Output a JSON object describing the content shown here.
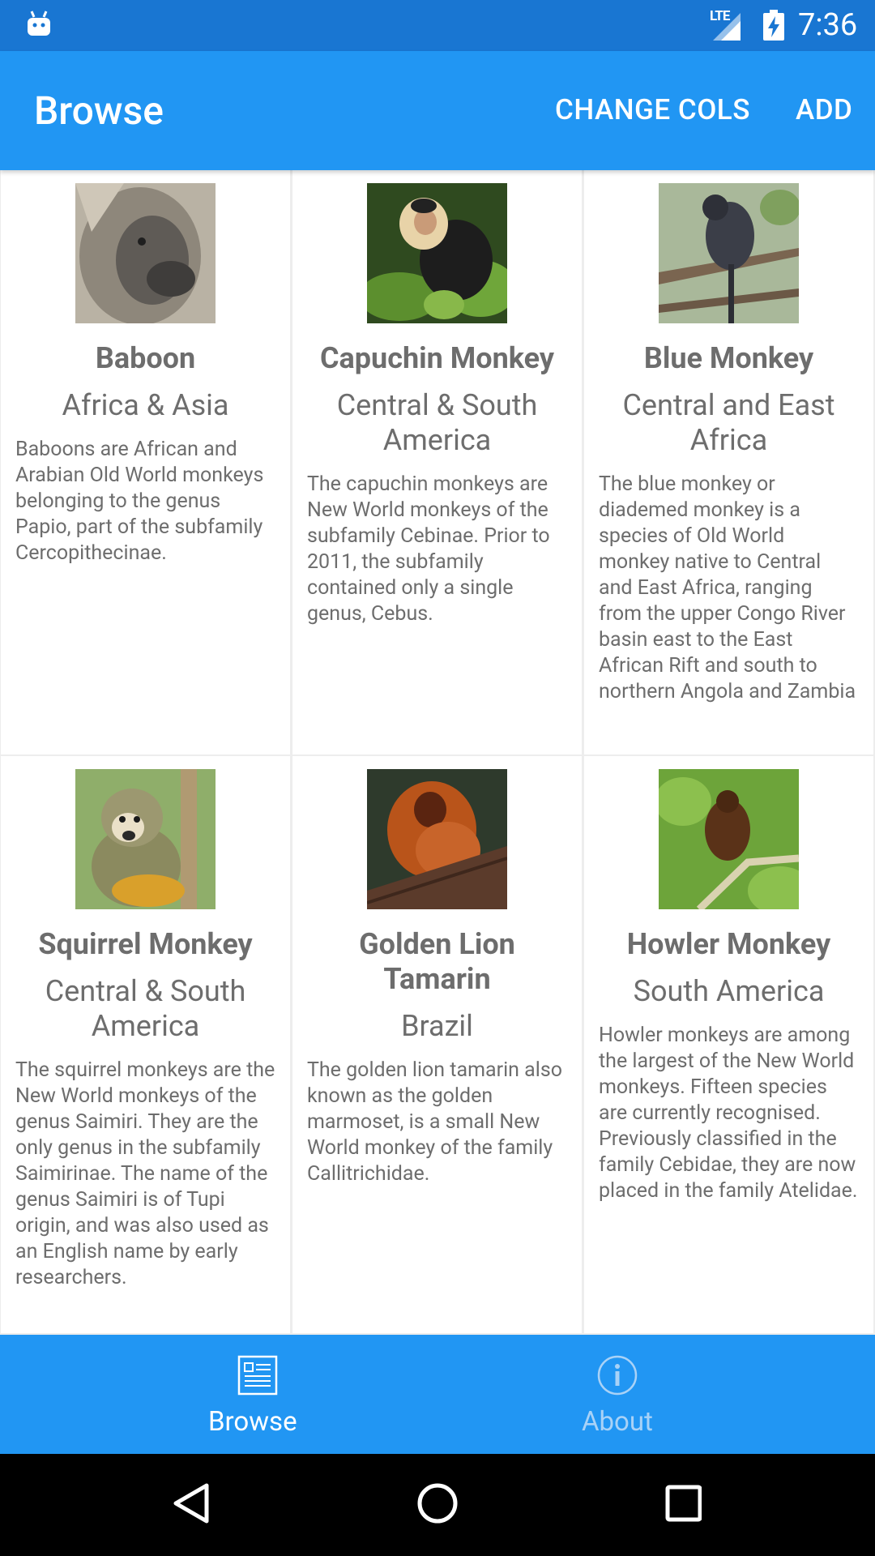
{
  "status_bar": {
    "network": "LTE",
    "time": "7:36",
    "icons": [
      "android-icon",
      "signal-icon",
      "battery-charging-icon"
    ]
  },
  "app_bar": {
    "title": "Browse",
    "actions": [
      "CHANGE COLS",
      "ADD"
    ]
  },
  "animals": [
    {
      "name": "Baboon",
      "region": "Africa & Asia",
      "description": "Baboons are African and Arabian Old World monkeys belonging to the genus Papio, part of the subfamily Cercopithecinae."
    },
    {
      "name": "Capuchin Monkey",
      "region": "Central & South America",
      "description": "The capuchin monkeys are New World monkeys of the subfamily Cebinae. Prior to 2011, the subfamily contained only a single genus, Cebus."
    },
    {
      "name": "Blue Monkey",
      "region": "Central and East Africa",
      "description": "The blue monkey or diademed monkey is a species of Old World monkey native to Central and East Africa, ranging from the upper Congo River basin east to the East African Rift and south to northern Angola and Zambia"
    },
    {
      "name": "Squirrel Monkey",
      "region": "Central & South America",
      "description": "The squirrel monkeys are the New World monkeys of the genus Saimiri. They are the only genus in the subfamily Saimirinae. The name of the genus Saimiri is of Tupi origin, and was also used as an English name by early researchers."
    },
    {
      "name": "Golden Lion Tamarin",
      "region": "Brazil",
      "description": "The golden lion tamarin also known as the golden marmoset, is a small New World monkey of the family Callitrichidae."
    },
    {
      "name": "Howler Monkey",
      "region": "South America",
      "description": "Howler monkeys are among the largest of the New World monkeys. Fifteen species are currently recognised. Previously classified in the family Cebidae, they are now placed in the family Atelidae."
    }
  ],
  "bottom_nav": {
    "items": [
      {
        "label": "Browse",
        "icon": "browse-list-icon",
        "selected": true
      },
      {
        "label": "About",
        "icon": "info-icon",
        "selected": false
      }
    ]
  },
  "colors": {
    "primary": "#2196f3",
    "primary_dark": "#1976d2",
    "text": "#6d6d6d"
  }
}
